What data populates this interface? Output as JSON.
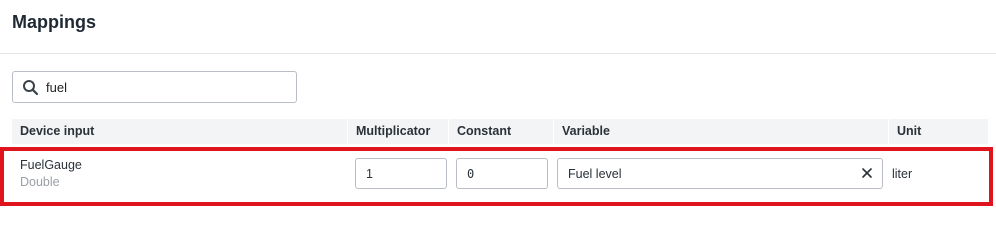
{
  "header": {
    "title": "Mappings"
  },
  "search": {
    "value": "fuel",
    "icon": "search-icon"
  },
  "table": {
    "columns": [
      "Device input",
      "Multiplicator",
      "Constant",
      "Variable",
      "Unit"
    ],
    "rows": [
      {
        "device_input": "FuelGauge",
        "data_type": "Double",
        "multiplicator": "1",
        "constant": "0",
        "variable": "Fuel level",
        "unit": "liter"
      }
    ]
  },
  "colors": {
    "highlight": "#e0141c",
    "header_bg": "#f3f4f6"
  }
}
